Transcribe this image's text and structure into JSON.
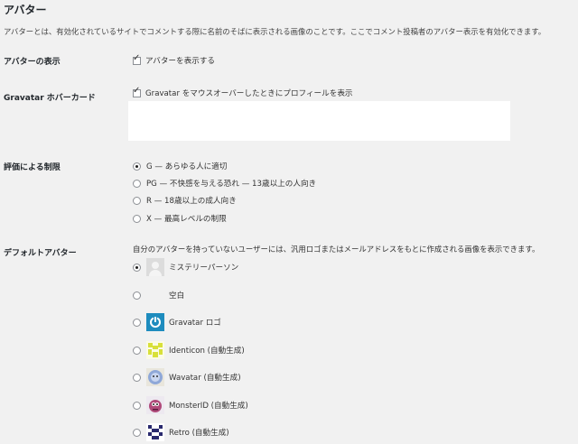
{
  "section": {
    "title": "アバター",
    "description": "アバターとは、有効化されているサイトでコメントする際に名前のそばに表示される画像のことです。ここでコメント投稿者のアバター表示を有効化できます。"
  },
  "show_avatars": {
    "label": "アバターの表示",
    "checkbox_label": "アバターを表示する",
    "checked": true
  },
  "hovercards": {
    "label": "Gravatar ホバーカード",
    "checkbox_label": "Gravatar をマウスオーバーしたときにプロフィールを表示",
    "checked": true
  },
  "rating": {
    "label": "評価による制限",
    "options": [
      {
        "label": "G — あらゆる人に適切",
        "selected": true
      },
      {
        "label": "PG — 不快感を与える恐れ — 13歳以上の人向き",
        "selected": false
      },
      {
        "label": "R — 18歳以上の成人向き",
        "selected": false
      },
      {
        "label": "X — 最高レベルの制限",
        "selected": false
      }
    ]
  },
  "default_avatar": {
    "label": "デフォルトアバター",
    "description": "自分のアバターを持っていないユーザーには、汎用ロゴまたはメールアドレスをもとに作成される画像を表示できます。",
    "options": [
      {
        "label": "ミステリーパーソン",
        "icon": "mystery-person-icon",
        "selected": true
      },
      {
        "label": "空白",
        "icon": "blank-icon",
        "selected": false
      },
      {
        "label": "Gravatar ロゴ",
        "icon": "gravatar-logo-icon",
        "selected": false
      },
      {
        "label": "Identicon (自動生成)",
        "icon": "identicon-icon",
        "selected": false
      },
      {
        "label": "Wavatar (自動生成)",
        "icon": "wavatar-icon",
        "selected": false
      },
      {
        "label": "MonsterID (自動生成)",
        "icon": "monsterid-icon",
        "selected": false
      },
      {
        "label": "Retro (自動生成)",
        "icon": "retro-icon",
        "selected": false
      }
    ]
  },
  "colors": {
    "background": "#f1f1f1",
    "text": "#23282d",
    "gravatar_blue": "#1e8cbe",
    "identicon_yellow": "#d8e03a",
    "monster_pink": "#b04a7a",
    "retro_navy": "#2a2a6e"
  }
}
